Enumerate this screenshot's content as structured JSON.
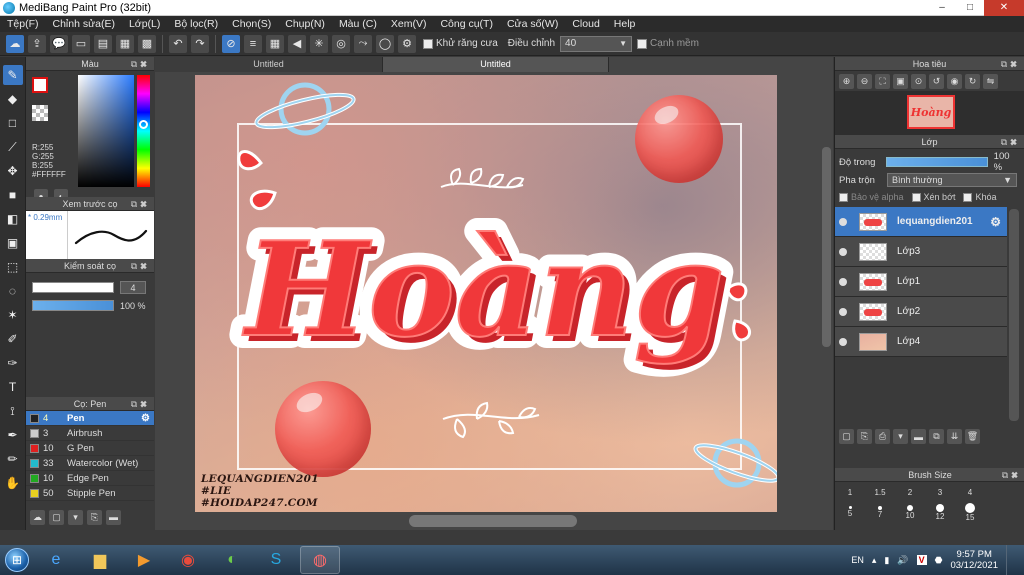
{
  "window": {
    "title": "MediBang Paint Pro (32bit)",
    "min": "–",
    "max": "□",
    "close": "✕"
  },
  "menu": [
    "Tệp(F)",
    "Chỉnh sửa(E)",
    "Lớp(L)",
    "Bộ lọc(R)",
    "Chọn(S)",
    "Chụp(N)",
    "Màu (C)",
    "Xem(V)",
    "Công cụ(T)",
    "Cửa số(W)",
    "Cloud",
    "Help"
  ],
  "toolbar": {
    "antialias_label": "Khử răng cưa",
    "adjust_label": "Điều chỉnh",
    "adjust_value": "40",
    "snap_label": "Cạnh mềm"
  },
  "color_panel": {
    "title": "Màu",
    "r": "R:255",
    "g": "G:255",
    "b": "B:255",
    "hex": "#FFFFFF"
  },
  "brush_preview": {
    "title": "Xem trước cọ",
    "size": "0.29mm"
  },
  "brush_control": {
    "title": "Kiểm soát cọ",
    "size_value": "4",
    "opacity_value": "100 %"
  },
  "brush_panel": {
    "title": "Cọ: Pen",
    "items": [
      {
        "num": "4",
        "name": "Pen",
        "color": "#222222",
        "active": true
      },
      {
        "num": "3",
        "name": "Airbrush",
        "color": "#cccccc",
        "active": false
      },
      {
        "num": "10",
        "name": "G Pen",
        "color": "#e02020",
        "active": false
      },
      {
        "num": "33",
        "name": "Watercolor (Wet)",
        "color": "#22bbcc",
        "active": false
      },
      {
        "num": "10",
        "name": "Edge Pen",
        "color": "#22aa22",
        "active": false
      },
      {
        "num": "50",
        "name": "Stipple Pen",
        "color": "#e8d020",
        "active": false
      }
    ]
  },
  "canvas": {
    "tabs": [
      "Untitled",
      "Untitled"
    ],
    "title_text": "Hoàng",
    "watermark": [
      "LEQUANGDIEN201",
      "#LIE",
      "#HOIDAP247.COM"
    ]
  },
  "navigator": {
    "title": "Hoa tiêu",
    "thumb_text": "Hoàng"
  },
  "layer_panel": {
    "title": "Lớp",
    "opacity_label": "Độ trong",
    "opacity_value": "100 %",
    "opacity_fraction": 1.0,
    "blend_label": "Pha trộn",
    "blend_value": "Bình thường",
    "protect_alpha": "Bảo vệ alpha",
    "clipping": "Xén bớt",
    "lock": "Khóa",
    "layers": [
      {
        "name": "lequangdien201",
        "active": true,
        "thumb": "txt"
      },
      {
        "name": "Lớp3",
        "active": false,
        "thumb": "plain"
      },
      {
        "name": "Lớp1",
        "active": false,
        "thumb": "txt"
      },
      {
        "name": "Lớp2",
        "active": false,
        "thumb": "txt"
      },
      {
        "name": "Lớp4",
        "active": false,
        "thumb": "bg"
      }
    ]
  },
  "brush_size": {
    "title": "Brush Size",
    "row1": [
      "1",
      "1.5",
      "2",
      "3",
      "4"
    ],
    "row2": [
      "5",
      "7",
      "10",
      "12",
      "15"
    ]
  },
  "taskbar": {
    "lang": "EN",
    "time": "9:57 PM",
    "date": "03/12/2021"
  }
}
